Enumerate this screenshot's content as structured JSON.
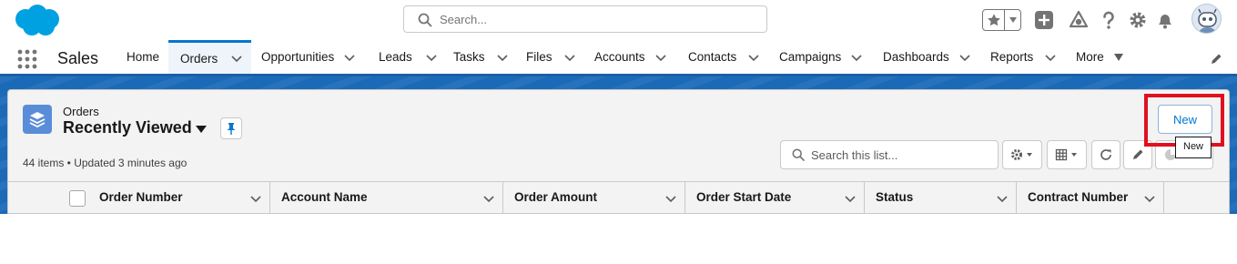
{
  "header": {
    "search_placeholder": "Search...",
    "icons": [
      "salesforce-logo",
      "search-icon",
      "favorites-star-icon",
      "favorites-dropdown-icon",
      "global-add-icon",
      "trailhead-icon",
      "help-icon",
      "setup-gear-icon",
      "notifications-bell-icon",
      "user-avatar"
    ]
  },
  "nav": {
    "app_name": "Sales",
    "items": [
      {
        "label": "Home"
      },
      {
        "label": "Orders"
      },
      {
        "label": "Opportunities"
      },
      {
        "label": "Leads"
      },
      {
        "label": "Tasks"
      },
      {
        "label": "Files"
      },
      {
        "label": "Accounts"
      },
      {
        "label": "Contacts"
      },
      {
        "label": "Campaigns"
      },
      {
        "label": "Dashboards"
      },
      {
        "label": "Reports"
      },
      {
        "label": "More"
      }
    ],
    "active": "Orders"
  },
  "list_view": {
    "object_label": "Orders",
    "title": "Recently Viewed",
    "meta": "44 items • Updated 3 minutes ago",
    "new_button": "New",
    "tooltip": "New",
    "search_placeholder": "Search this list...",
    "columns": [
      {
        "label": "Order Number"
      },
      {
        "label": "Account Name"
      },
      {
        "label": "Order Amount"
      },
      {
        "label": "Order Start Date"
      },
      {
        "label": "Status"
      },
      {
        "label": "Contract Number"
      }
    ]
  },
  "colors": {
    "brand_blue": "#1b6ab8",
    "accent": "#0176d3",
    "highlight_red": "#e0101f"
  }
}
